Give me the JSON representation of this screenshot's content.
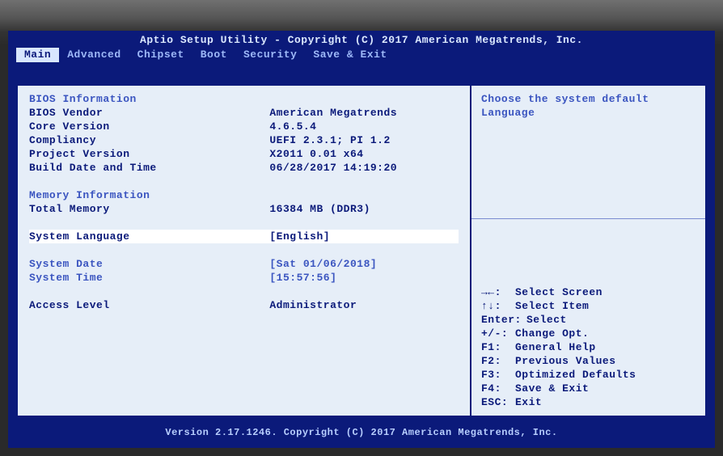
{
  "header": {
    "title": "Aptio Setup Utility - Copyright (C) 2017 American Megatrends, Inc."
  },
  "tabs": {
    "main": "Main",
    "advanced": "Advanced",
    "chipset": "Chipset",
    "boot": "Boot",
    "security": "Security",
    "save_exit": "Save & Exit"
  },
  "left": {
    "bios_info_head": "BIOS Information",
    "vendor_label": "BIOS Vendor",
    "vendor_value": "American Megatrends",
    "core_label": "Core Version",
    "core_value": "4.6.5.4",
    "compliancy_label": "Compliancy",
    "compliancy_value": "UEFI 2.3.1; PI 1.2",
    "project_label": "Project Version",
    "project_value": "X2011 0.01 x64",
    "build_label": "Build Date and Time",
    "build_value": "06/28/2017 14:19:20",
    "mem_info_head": "Memory Information",
    "total_mem_label": "Total Memory",
    "total_mem_value": "16384 MB (DDR3)",
    "lang_label": "System Language",
    "lang_value": "[English]",
    "date_label": "System Date",
    "date_value": "[Sat 01/06/2018]",
    "time_label": "System Time",
    "time_value": "[15:57:56]",
    "access_label": "Access Level",
    "access_value": "Administrator"
  },
  "right": {
    "help": "Choose the system default Language"
  },
  "keys": {
    "arrows_lr": {
      "k": "→←:",
      "d": "Select Screen"
    },
    "arrows_ud": {
      "k": "↑↓:",
      "d": "Select Item"
    },
    "enter": {
      "k": "Enter:",
      "d": "Select"
    },
    "plusminus": {
      "k": "+/-:",
      "d": "Change Opt."
    },
    "f1": {
      "k": "F1:",
      "d": "General Help"
    },
    "f2": {
      "k": "F2:",
      "d": "Previous Values"
    },
    "f3": {
      "k": "F3:",
      "d": "Optimized Defaults"
    },
    "f4": {
      "k": "F4:",
      "d": "Save & Exit"
    },
    "esc": {
      "k": "ESC:",
      "d": "Exit"
    }
  },
  "footer": {
    "text": "Version 2.17.1246. Copyright (C) 2017 American Megatrends, Inc."
  }
}
